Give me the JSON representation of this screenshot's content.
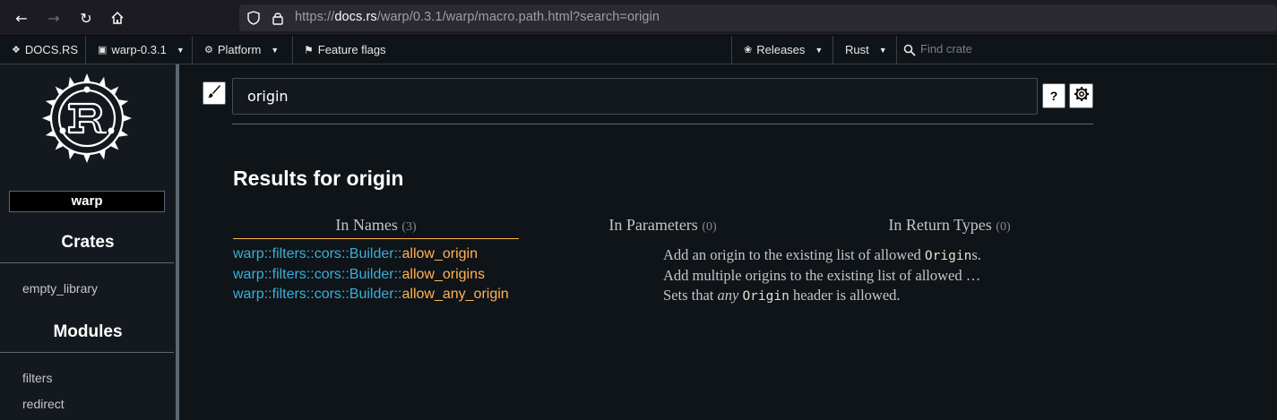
{
  "browser": {
    "url_prefix": "https://",
    "url_host": "docs.rs",
    "url_path": "/warp/0.3.1/warp/macro.path.html?search=origin"
  },
  "topnav": {
    "logo_label": "DOCS.RS",
    "crate_label": "warp-0.3.1",
    "platform_label": "Platform",
    "feature_flags_label": "Feature flags",
    "releases_label": "Releases",
    "rust_label": "Rust",
    "find_crate_placeholder": "Find crate"
  },
  "sidebar": {
    "crate_name": "warp",
    "crates_heading": "Crates",
    "crates": [
      "empty_library"
    ],
    "modules_heading": "Modules",
    "modules": [
      "filters",
      "redirect"
    ]
  },
  "search": {
    "query": "origin",
    "help_label": "?"
  },
  "results": {
    "title": "Results for origin",
    "tabs": [
      {
        "label": "In Names",
        "count": "(3)",
        "active": true
      },
      {
        "label": "In Parameters",
        "count": "(0)",
        "active": false
      },
      {
        "label": "In Return Types",
        "count": "(0)",
        "active": false
      }
    ],
    "items": [
      {
        "path": "warp::filters::cors::Builder::",
        "name": "allow_origin",
        "desc_parts": [
          "Add an origin to the existing list of allowed ",
          "Origin",
          "s."
        ]
      },
      {
        "path": "warp::filters::cors::Builder::",
        "name": "allow_origins",
        "desc_parts": [
          "Add multiple origins to the existing list of allowed …"
        ]
      },
      {
        "path": "warp::filters::cors::Builder::",
        "name": "allow_any_origin",
        "desc_parts": [
          "Sets that ",
          "any",
          " ",
          "Origin",
          " header is allowed."
        ]
      }
    ]
  }
}
